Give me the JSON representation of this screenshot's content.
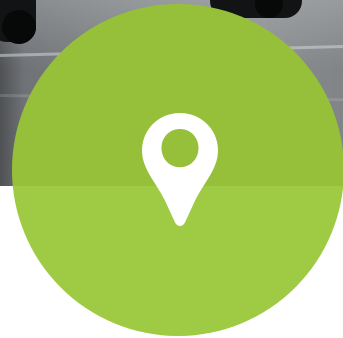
{
  "background": {
    "photo_colors": [
      "#4f5154",
      "#777b7e",
      "#898d90",
      "#111315"
    ],
    "page_color": "#ffffff"
  },
  "marker": {
    "icon": "map-pin-icon",
    "circle_color": "#9fca43",
    "pin_color": "#ffffff"
  }
}
